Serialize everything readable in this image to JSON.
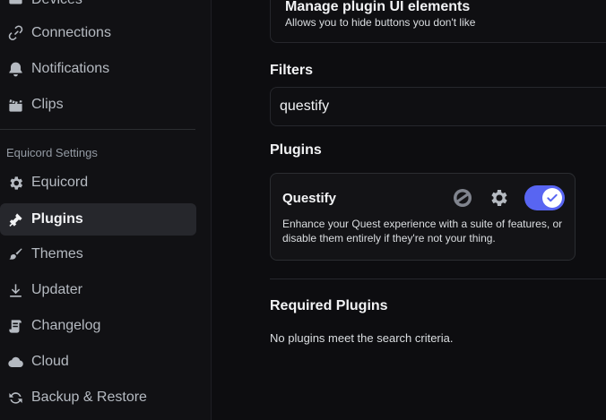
{
  "sidebar": {
    "items": [
      {
        "label": "Devices",
        "icon": "devices-icon"
      },
      {
        "label": "Connections",
        "icon": "link-icon"
      },
      {
        "label": "Notifications",
        "icon": "bell-icon"
      },
      {
        "label": "Clips",
        "icon": "clapperboard-icon"
      }
    ],
    "section_header": "Equicord Settings",
    "equicord_items": [
      {
        "label": "Equicord",
        "icon": "gear-icon"
      },
      {
        "label": "Plugins",
        "icon": "puzzle-icon",
        "active": true
      },
      {
        "label": "Themes",
        "icon": "paintbrush-icon"
      },
      {
        "label": "Updater",
        "icon": "download-icon"
      },
      {
        "label": "Changelog",
        "icon": "scroll-icon"
      },
      {
        "label": "Cloud",
        "icon": "cloud-icon"
      },
      {
        "label": "Backup & Restore",
        "icon": "backup-icon"
      }
    ]
  },
  "main": {
    "top_card": {
      "title": "Manage plugin UI elements",
      "subtitle": "Allows you to hide buttons you don't like"
    },
    "filters_heading": "Filters",
    "search_value": "questify",
    "plugins_heading": "Plugins",
    "plugin": {
      "name": "Questify",
      "description": "Enhance your Quest experience with a suite of features, or disable them entirely if they're not your thing.",
      "enabled": true
    },
    "required_heading": "Required Plugins",
    "empty_text": "No plugins meet the search criteria."
  },
  "colors": {
    "accent": "#5865f2",
    "background": "#0d0d10",
    "sidebar": "#111114"
  }
}
